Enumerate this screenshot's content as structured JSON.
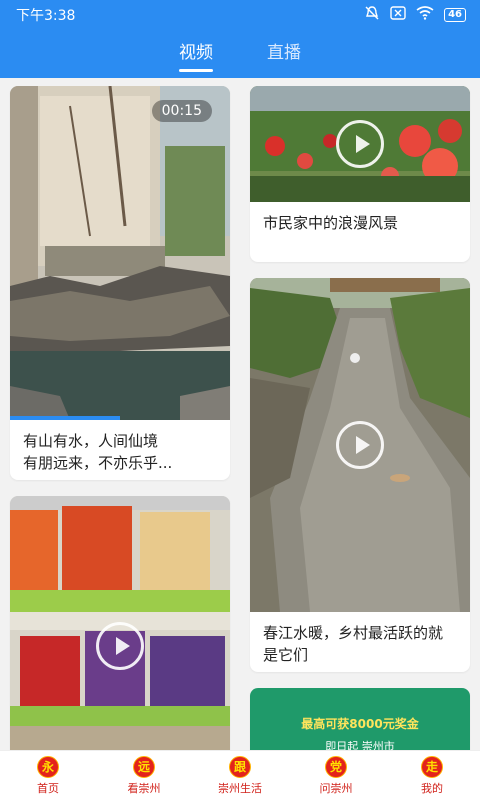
{
  "status": {
    "time": "下午3:38",
    "battery": "46"
  },
  "tabs": [
    {
      "label": "视频"
    },
    {
      "label": "直播"
    }
  ],
  "cards": [
    {
      "caption": "有山有水，人间仙境\n有朋远来，不亦乐乎...",
      "duration": "00:15"
    },
    {
      "caption": "市民家中的浪漫风景"
    },
    {
      "caption": "春江水暖，乡村最活跃的就是它们"
    },
    {
      "caption": ""
    },
    {
      "banner_text": "最高可获8000元奖金",
      "banner_sub": "即日起 崇州市"
    }
  ],
  "bottom_nav": [
    {
      "icon": "永",
      "label": "首页"
    },
    {
      "icon": "远",
      "label": "看崇州"
    },
    {
      "icon": "跟",
      "label": "崇州生活"
    },
    {
      "icon": "党",
      "label": "问崇州"
    },
    {
      "icon": "走",
      "label": "我的"
    }
  ],
  "colors": {
    "brand": "#2b8cf2",
    "nav_red": "#d1211a",
    "nav_icon_bg": "#e3231c"
  }
}
